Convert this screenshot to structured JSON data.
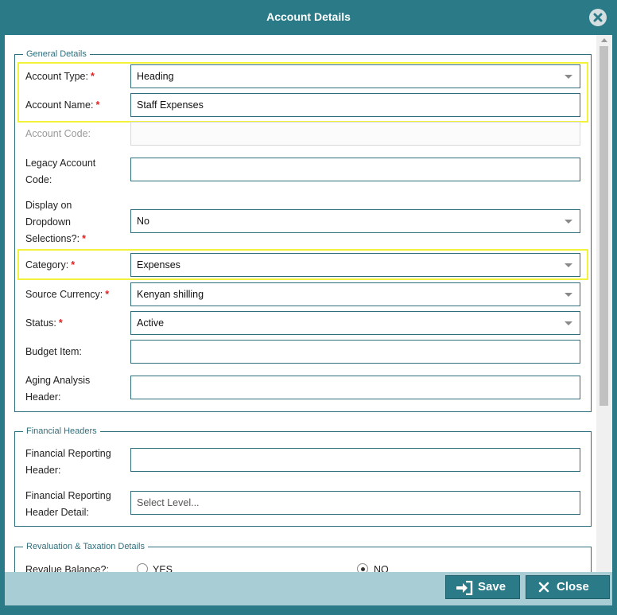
{
  "window": {
    "title": "Account Details"
  },
  "general": {
    "legend": "General Details",
    "account_type": {
      "label": "Account Type:",
      "value": "Heading"
    },
    "account_name": {
      "label": "Account Name:",
      "value": "Staff Expenses"
    },
    "account_code": {
      "label": "Account Code:",
      "value": ""
    },
    "legacy_code": {
      "label_line1": "Legacy Account",
      "label_line2": "Code:",
      "value": ""
    },
    "display_dropdown": {
      "label_line1": "Display on",
      "label_line2": "Dropdown",
      "label_line3": "Selections?:",
      "value": "No"
    },
    "category": {
      "label": "Category:",
      "value": "Expenses"
    },
    "source_currency": {
      "label": "Source Currency:",
      "value": "Kenyan shilling"
    },
    "status": {
      "label": "Status:",
      "value": "Active"
    },
    "budget_item": {
      "label": "Budget Item:",
      "value": ""
    },
    "aging_header": {
      "label_line1": "Aging Analysis",
      "label_line2": "Header:",
      "value": ""
    },
    "required_mark": "*"
  },
  "financial": {
    "legend": "Financial Headers",
    "reporting_header": {
      "label_line1": "Financial Reporting",
      "label_line2": "Header:",
      "value": ""
    },
    "reporting_detail": {
      "label_line1": "Financial Reporting",
      "label_line2": "Header Detail:",
      "placeholder": "Select Level..."
    }
  },
  "revaluation": {
    "legend": "Revaluation & Taxation Details",
    "revalue_label": "Revalue Balance?:",
    "yes_label": "YES",
    "no_label": "NO",
    "selected": "NO"
  },
  "footer": {
    "save_label": "Save",
    "close_label": "Close"
  },
  "colors": {
    "teal": "#2b7a88",
    "footer": "#a8cdd4",
    "required": "#e02020",
    "highlight": "#f2f23a"
  }
}
